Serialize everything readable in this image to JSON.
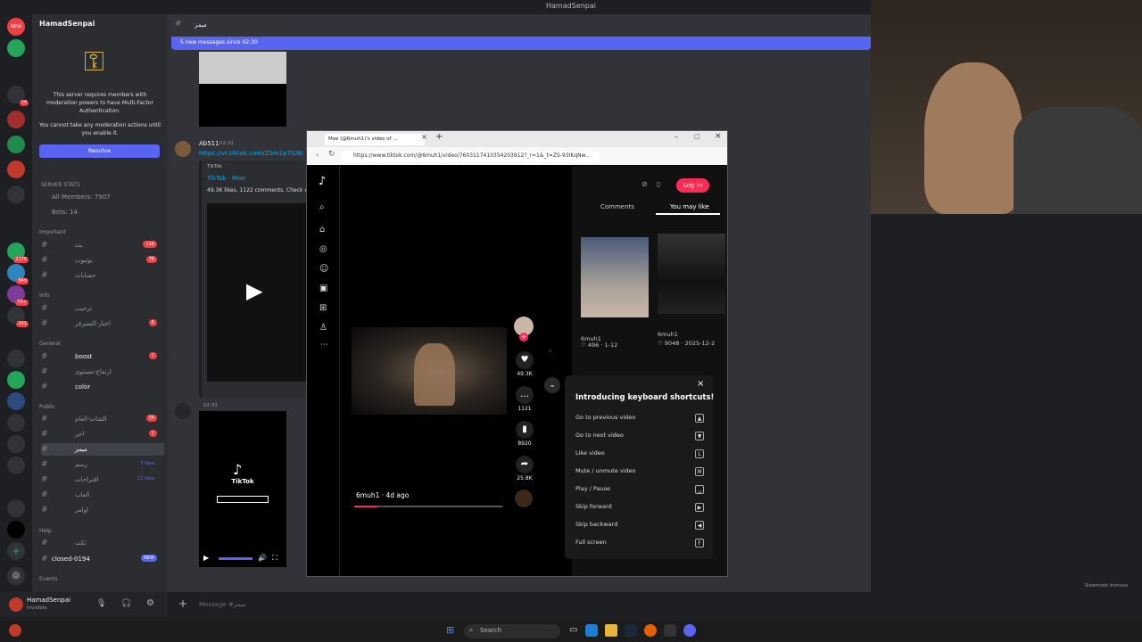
{
  "window": {
    "title": "HamadSenpai"
  },
  "discord": {
    "server_name": "HamadSenpai",
    "mfa_notice": "This server requires members with moderation powers to have Multi-Factor Authentication.",
    "mfa_notice2": "You cannot take any moderation actions until you enable it.",
    "resolve_label": "Resolve",
    "stats_header": "SERVER STATS",
    "all_members": "All Members: 7907",
    "bots": "Bots: 14",
    "categories": [
      "Important",
      "Info",
      "General",
      "Public",
      "Help",
      "Events"
    ],
    "channels": [
      {
        "name": "بث",
        "badge": "128"
      },
      {
        "name": "يوتيوب",
        "badge": "76"
      },
      {
        "name": "حسابات",
        "badge": ""
      },
      {
        "name": "ترحيب",
        "badge": ""
      },
      {
        "name": "اخبار-السيرفر",
        "badge": "6"
      },
      {
        "name": "boost",
        "badge": "1"
      },
      {
        "name": "ارتفاع-مستوى",
        "badge": ""
      },
      {
        "name": "color",
        "badge": ""
      },
      {
        "name": "الشات-العام",
        "badge": "34"
      },
      {
        "name": "اجر",
        "badge": "1"
      },
      {
        "name": "ميمز",
        "badge": ""
      },
      {
        "name": "رسم",
        "badge": "3 New"
      },
      {
        "name": "اقتراحات",
        "badge": "12 New"
      },
      {
        "name": "العاب",
        "badge": ""
      },
      {
        "name": "اوامر",
        "badge": ""
      },
      {
        "name": "تكت",
        "badge": ""
      },
      {
        "name": "closed-0194",
        "badge": "NEW"
      }
    ],
    "user_name": "HamadSenpai",
    "user_status": "Invisible",
    "channel_title": "ميمز",
    "new_messages": "5 new messages since 02:30",
    "message_author": "Ab511",
    "message_time": "02:31",
    "message_link": "https://vt.tiktok.com/ZSm1p7IU8/",
    "embed_site": "TikTok",
    "embed_title": "TikTok · Moe",
    "embed_desc": "49.3K likes, 1122 comments. Check ou",
    "second_time": "02:31",
    "tiktok_logo_text": "TikTok",
    "message_placeholder": "Message #ميمز",
    "slowmode": "Slowmode immune"
  },
  "browser": {
    "tab_title": "Moe (@6muh1)'s video of ...",
    "url": "https://www.tiktok.com/@6muh1/video/7603117410354203912?_r=1&_t=ZS-93IKqNw...",
    "login": "Log in",
    "tab_comments": "Comments",
    "tab_you_may_like": "You may like",
    "author_line": "6muh1 · 4d ago",
    "likes": "49.3K",
    "comments": "1121",
    "saves": "8920",
    "shares": "25.8K",
    "rec1": {
      "user": "6muh1",
      "stats": "♡ 496 · 1-12"
    },
    "rec2": {
      "user": "6muh1",
      "stats": "♡ 9048 · 2025-12-2"
    },
    "shortcuts_title": "Introducing keyboard shortcuts!",
    "shortcuts": [
      {
        "label": "Go to previous video",
        "key": "▲"
      },
      {
        "label": "Go to next video",
        "key": "▼"
      },
      {
        "label": "Like video",
        "key": "L"
      },
      {
        "label": "Mute / unmute video",
        "key": "M"
      },
      {
        "label": "Play / Pause",
        "key": "␣"
      },
      {
        "label": "Skip forward",
        "key": "▶"
      },
      {
        "label": "Skip backward",
        "key": "◀"
      },
      {
        "label": "Full screen",
        "key": "F"
      }
    ]
  },
  "taskbar": {
    "search": "Search"
  },
  "colors": {
    "discord_blurple": "#5865f2",
    "tiktok_red": "#fe2c55",
    "danger": "#f23f43"
  }
}
